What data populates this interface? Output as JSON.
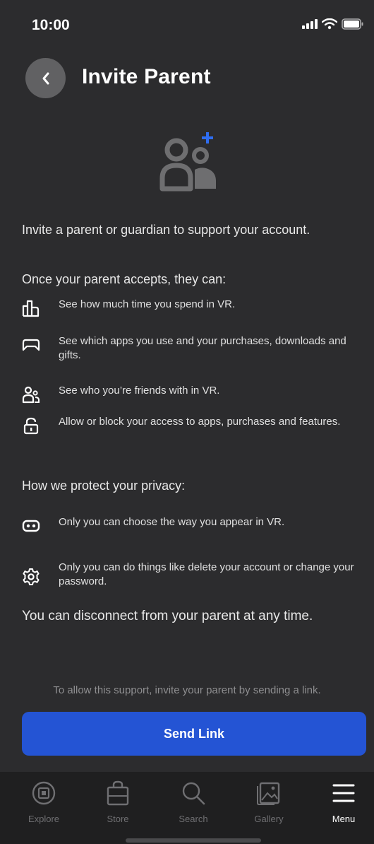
{
  "status": {
    "time": "10:00"
  },
  "header": {
    "title": "Invite Parent"
  },
  "intro": "Invite a parent or guardian to support your account.",
  "accepts_title": "Once your parent accepts, they can:",
  "accepts_items": [
    {
      "icon": "chart-icon",
      "text": "See how much time you spend in VR."
    },
    {
      "icon": "controller-icon",
      "text": "See which apps you use and your purchases, downloads and gifts."
    },
    {
      "icon": "friends-icon",
      "text": "See who you’re friends with in VR."
    },
    {
      "icon": "lock-icon",
      "text": "Allow or block your access to apps, purchases and features."
    }
  ],
  "privacy_title": "How we protect your privacy:",
  "privacy_items": [
    {
      "icon": "headset-icon",
      "text": "Only you can choose the way you appear in VR."
    },
    {
      "icon": "gear-icon",
      "text": "Only you can do things like delete your account or change your password."
    }
  ],
  "disconnect_note": "You can disconnect from your parent at any time.",
  "footer_note": "To allow this support, invite your parent by sending a link.",
  "send_button": "Send Link",
  "tabs": [
    {
      "label": "Explore",
      "icon": "explore-icon"
    },
    {
      "label": "Store",
      "icon": "store-icon"
    },
    {
      "label": "Search",
      "icon": "search-icon"
    },
    {
      "label": "Gallery",
      "icon": "gallery-icon"
    },
    {
      "label": "Menu",
      "icon": "menu-icon",
      "active": true
    }
  ],
  "colors": {
    "accent": "#2454d4",
    "background": "#2c2c2e",
    "plus": "#2f6df0"
  }
}
